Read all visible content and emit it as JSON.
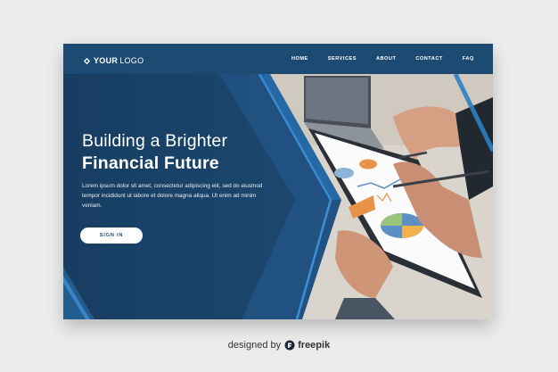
{
  "nav": {
    "logo_bold": "YOUR",
    "logo_light": "LOGO",
    "items": [
      "HOME",
      "SERVICES",
      "ABOUT",
      "CONTACT",
      "FAQ"
    ]
  },
  "hero": {
    "headline_line1": "Building a Brighter",
    "headline_line2": "Financial Future",
    "body": "Lorem ipsum dolor sit amet, consectetur adipiscing elit, sed do eiusmod tempor incididunt ut labore et dolore magna aliqua. Ut enim ad minim veniam.",
    "button_label": "SIGN IN"
  },
  "footer": {
    "prefix": "designed by",
    "brand": "freepik"
  },
  "colors": {
    "card_bg": "#1d4a72",
    "accent_blue": "#2a7fc7",
    "page_bg": "#ececec"
  },
  "icons": {
    "logo": "diamond-icon",
    "footer": "freepik-icon"
  }
}
